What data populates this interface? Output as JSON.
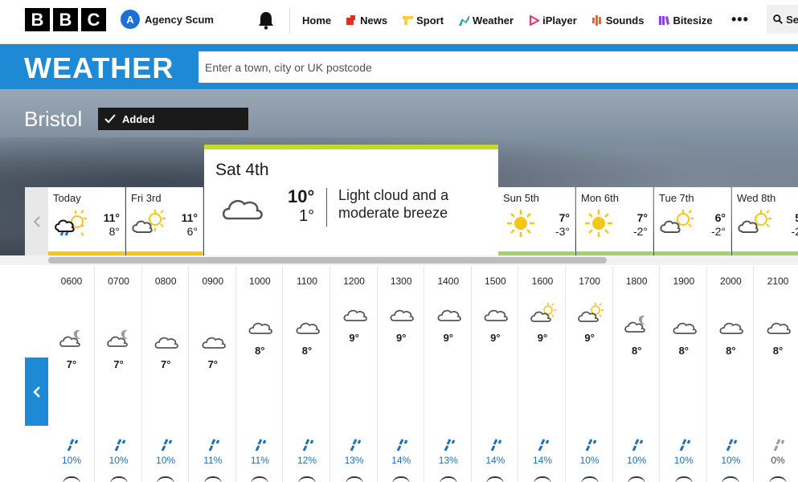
{
  "nav": {
    "logo": [
      "B",
      "B",
      "C"
    ],
    "account_initial": "A",
    "account_name": "Agency Scum",
    "links": [
      {
        "label": "Home",
        "icon": "none",
        "color": ""
      },
      {
        "label": "News",
        "icon": "news-icon",
        "color": "#e32d1f"
      },
      {
        "label": "Sport",
        "icon": "sport-icon",
        "color": "#ffd230"
      },
      {
        "label": "Weather",
        "icon": "weather-icon",
        "color": "#1ba3a3"
      },
      {
        "label": "iPlayer",
        "icon": "iplayer-icon",
        "color": "#e8336f"
      },
      {
        "label": "Sounds",
        "icon": "sounds-icon",
        "color": "#f4632b"
      },
      {
        "label": "Bitesize",
        "icon": "bitesize-icon",
        "color": "#8d3fdb"
      }
    ],
    "more_label": "•••",
    "search_label": "Se"
  },
  "weather": {
    "title": "WEATHER",
    "search_placeholder": "Enter a town, city or UK postcode"
  },
  "location": {
    "city": "Bristol",
    "added_label": "Added"
  },
  "days": [
    {
      "name": "Today",
      "date": "",
      "hi": "11°",
      "lo": "8°",
      "icon": "sun-cloud-rain-icon"
    },
    {
      "name": "Fri",
      "date": "3rd",
      "hi": "11°",
      "lo": "6°",
      "icon": "sun-cloud-icon"
    },
    {
      "name": "Sun",
      "date": "5th",
      "hi": "7°",
      "lo": "-3°",
      "icon": "sun-icon"
    },
    {
      "name": "Mon",
      "date": "6th",
      "hi": "7°",
      "lo": "-2°",
      "icon": "sun-icon"
    },
    {
      "name": "Tue",
      "date": "7th",
      "hi": "6°",
      "lo": "-2°",
      "icon": "sun-cloud-icon"
    },
    {
      "name": "Wed",
      "date": "8th",
      "hi": "5",
      "lo": "-2",
      "icon": "sun-cloud-icon"
    }
  ],
  "selected_day": {
    "name": "Sat",
    "date": "4th",
    "hi": "10°",
    "lo": "1°",
    "description": "Light cloud and a moderate breeze",
    "icon": "cloud-icon"
  },
  "hours": [
    {
      "time": "0600",
      "icon": "moon-cloud-icon",
      "temp": "7°",
      "rain": "10%"
    },
    {
      "time": "0700",
      "icon": "moon-cloud-icon",
      "temp": "7°",
      "rain": "10%"
    },
    {
      "time": "0800",
      "icon": "cloud-icon",
      "temp": "7°",
      "rain": "10%"
    },
    {
      "time": "0900",
      "icon": "cloud-icon",
      "temp": "7°",
      "rain": "11%"
    },
    {
      "time": "1000",
      "icon": "cloud-icon",
      "temp": "8°",
      "rain": "11%"
    },
    {
      "time": "1100",
      "icon": "cloud-icon",
      "temp": "8°",
      "rain": "12%"
    },
    {
      "time": "1200",
      "icon": "cloud-icon",
      "temp": "9°",
      "rain": "13%"
    },
    {
      "time": "1300",
      "icon": "cloud-icon",
      "temp": "9°",
      "rain": "14%"
    },
    {
      "time": "1400",
      "icon": "cloud-icon",
      "temp": "9°",
      "rain": "13%"
    },
    {
      "time": "1500",
      "icon": "cloud-icon",
      "temp": "9°",
      "rain": "14%"
    },
    {
      "time": "1600",
      "icon": "sun-cloud-icon",
      "temp": "9°",
      "rain": "14%"
    },
    {
      "time": "1700",
      "icon": "sun-cloud-icon",
      "temp": "9°",
      "rain": "10%"
    },
    {
      "time": "1800",
      "icon": "moon-cloud-icon",
      "temp": "8°",
      "rain": "10%"
    },
    {
      "time": "1900",
      "icon": "cloud-icon",
      "temp": "8°",
      "rain": "10%"
    },
    {
      "time": "2000",
      "icon": "cloud-icon",
      "temp": "8°",
      "rain": "10%"
    },
    {
      "time": "2100",
      "icon": "cloud-icon",
      "temp": "8°",
      "rain": "0%"
    }
  ]
}
